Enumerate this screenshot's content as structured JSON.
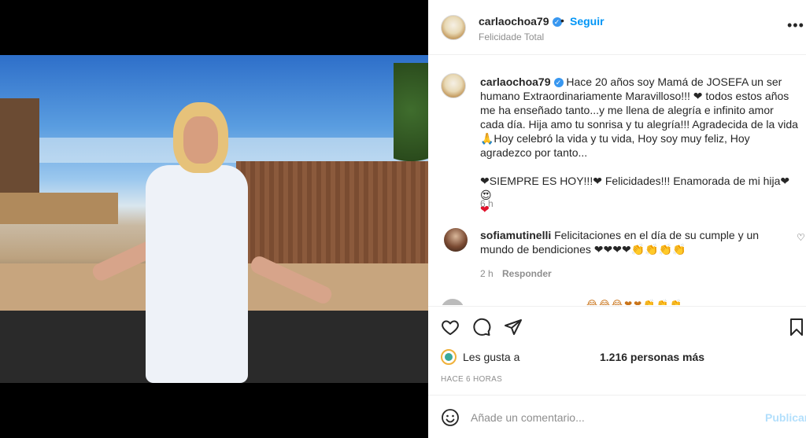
{
  "post": {
    "username": "carlaochoa79",
    "location": "Felicidade Total",
    "follow_label": "Seguir",
    "dot": "•",
    "more": "•••"
  },
  "caption": {
    "username": "carlaochoa79",
    "lines": [
      "Hace 20 años soy Mamá de JOSEFA un ser humano Extraordinariamente Maravilloso!!! ❤ todos estos años me ha enseñado tanto...y me llena de alegría e infinito amor cada día. Hija amo tu sonrisa y tu alegría!!! Agradecida de la vida🙏Hoy celebró la vida y tu vida, Hoy soy muy feliz, Hoy agradezco por tanto...",
      "❤SIEMPRE ES HOY!!!❤ Felicidades!!! Enamorada de mi hija❤😍",
      "❤"
    ],
    "time": "6 h"
  },
  "comment": {
    "username": "sofiamutinelli",
    "text": "Felicitaciones en el día de su cumple y un mundo de bendiciones ❤❤❤❤👏👏👏👏",
    "time": "2 h",
    "reply_label": "Responder"
  },
  "next_comment_emojis": "😂😂😂❤❤👏👏👏",
  "likes": {
    "prefix": "Les gusta a",
    "suffix": "1.216 personas más"
  },
  "posted_ago": "HACE 6 HORAS",
  "comment_box": {
    "placeholder": "Añade un comentario...",
    "post_label": "Publicar"
  },
  "icons": [
    "heart-icon",
    "comment-icon",
    "share-icon",
    "bookmark-icon",
    "emoji-icon",
    "verified-icon",
    "more-icon"
  ],
  "colors": {
    "link": "#0095f6",
    "heart": "#e0102a",
    "muted": "#8e8e8e",
    "text": "#262626",
    "publish_disabled": "#b2dffc"
  }
}
